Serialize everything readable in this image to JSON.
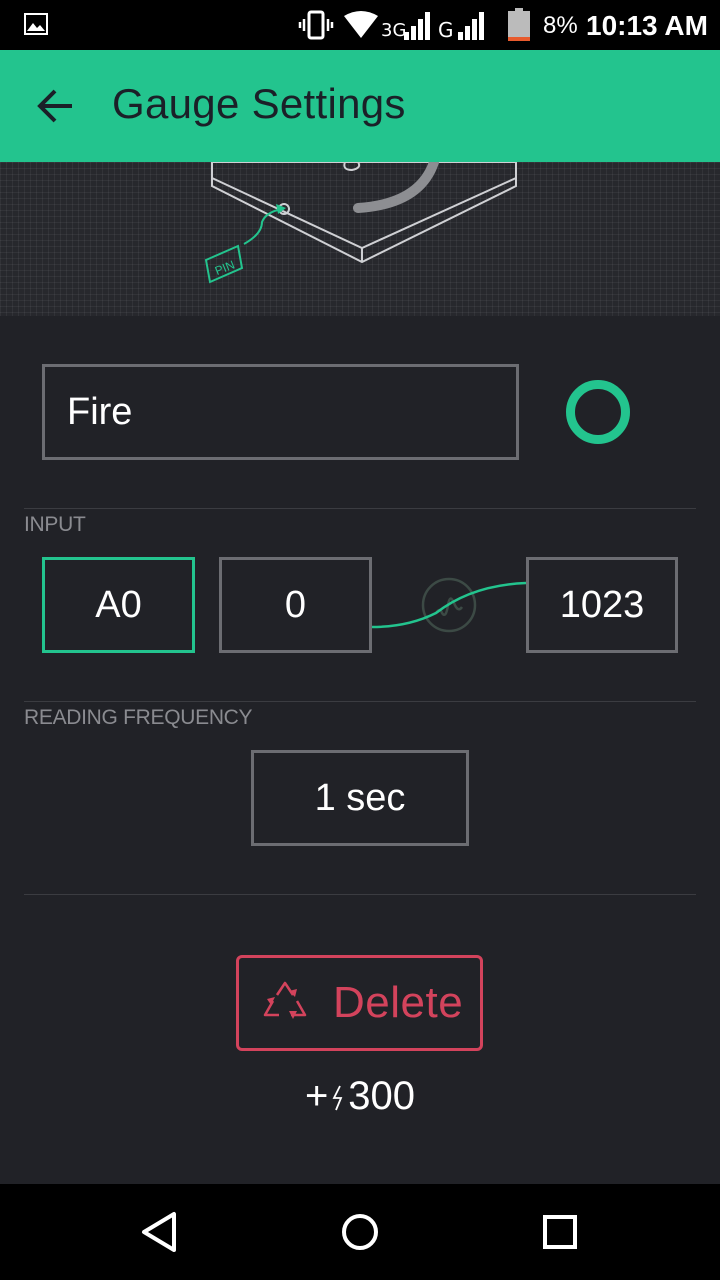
{
  "status_bar": {
    "network_primary": "3G",
    "network_secondary": "G",
    "battery_percent": "8%",
    "time": "10:13 AM",
    "icons": [
      "gallery-icon",
      "vibrate-icon",
      "wifi-icon",
      "signal-icon",
      "battery-icon"
    ]
  },
  "header": {
    "title": "Gauge Settings",
    "back_icon": "arrow-left-icon",
    "background_color": "#23c48e"
  },
  "illustration": {
    "pin_label": "PIN"
  },
  "widget": {
    "name_value": "Fire",
    "color": "#23c48e"
  },
  "input": {
    "section_label": "INPUT",
    "pin": "A0",
    "min": "0",
    "max": "1023"
  },
  "frequency": {
    "section_label": "READING FREQUENCY",
    "value": "1 sec"
  },
  "delete": {
    "label": "Delete",
    "icon": "recycle-icon",
    "color": "#d3435c"
  },
  "energy": {
    "prefix": "+",
    "icon": "bolt-icon",
    "amount": "300"
  },
  "nav": {
    "icons": [
      "back-triangle-icon",
      "home-circle-icon",
      "recents-square-icon"
    ]
  }
}
